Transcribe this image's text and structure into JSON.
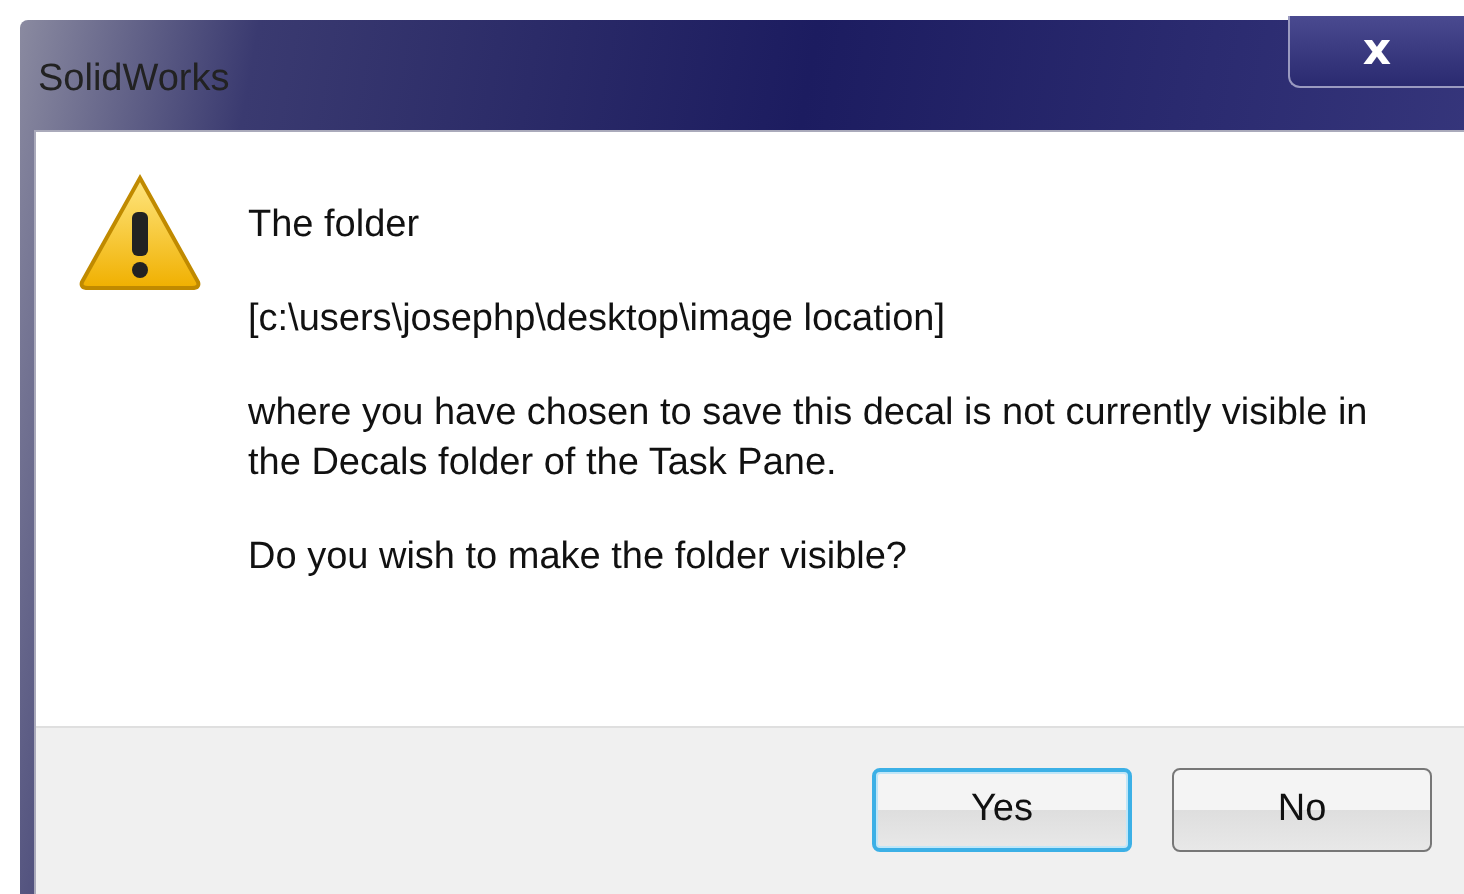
{
  "window": {
    "title": "SolidWorks",
    "close_label": "x"
  },
  "message": {
    "paragraphs": [
      "The folder",
      "[c:\\users\\josephp\\desktop\\image location]",
      "where you have chosen to save this decal is not currently visible in the Decals folder of the Task Pane.",
      "Do you wish to make the folder visible?"
    ]
  },
  "buttons": [
    {
      "label": "Yes",
      "selected": true
    },
    {
      "label": "No",
      "selected": false
    }
  ]
}
